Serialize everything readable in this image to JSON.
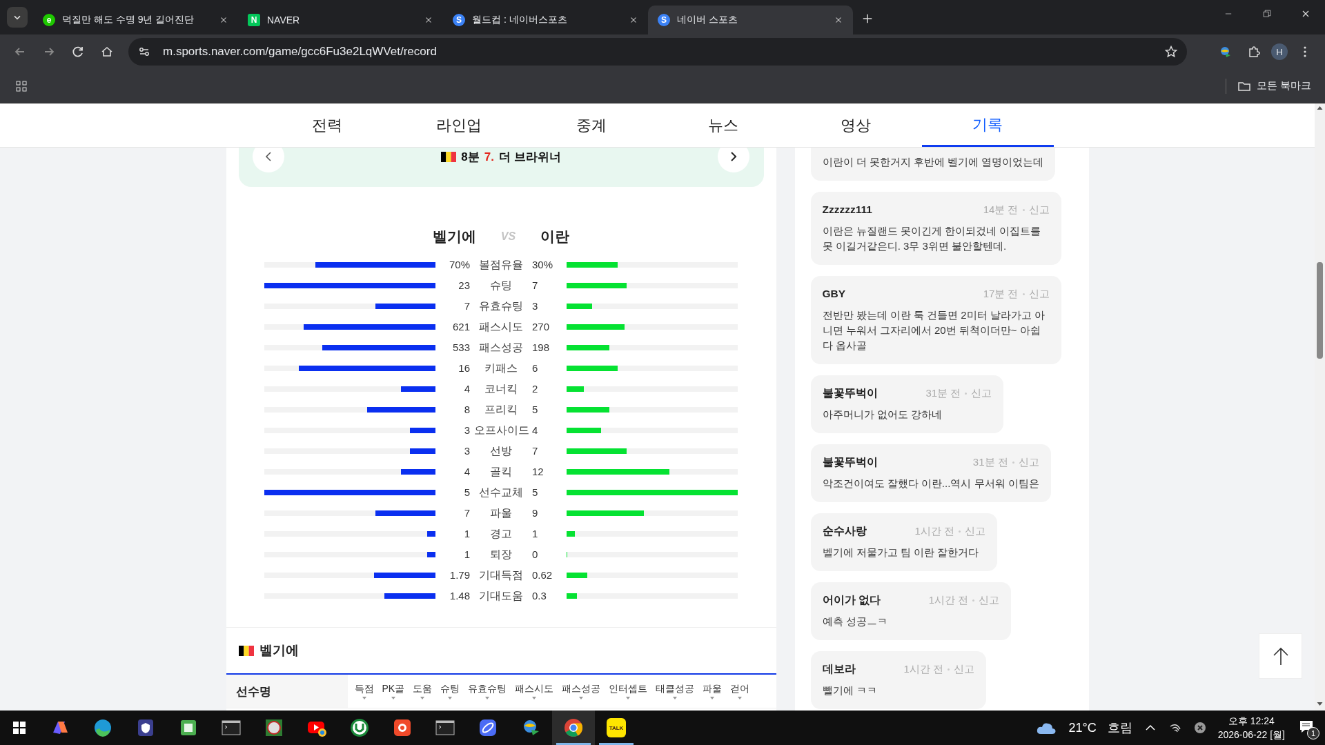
{
  "browser": {
    "tabs": [
      {
        "title": "덕질만 해도 수명 9년 길어진단",
        "favicon": {
          "kind": "circle",
          "color": "#1ec800",
          "letter": "e"
        },
        "selected": false
      },
      {
        "title": "NAVER",
        "favicon": {
          "kind": "square",
          "color": "#03c75a",
          "letter": "N"
        },
        "selected": false
      },
      {
        "title": "월드컵 : 네이버스포츠",
        "favicon": {
          "kind": "circle",
          "color": "#3b82f6",
          "letter": "S"
        },
        "selected": false
      },
      {
        "title": "네이버 스포츠",
        "favicon": {
          "kind": "circle",
          "color": "#3b82f6",
          "letter": "S"
        },
        "selected": true
      }
    ],
    "url": "m.sports.naver.com/game/gcc6Fu3e2LqWVet/record",
    "profile": "H",
    "bookmarks_label": "모든 북마크"
  },
  "nav": [
    {
      "label": "전력",
      "selected": false
    },
    {
      "label": "라인업",
      "selected": false
    },
    {
      "label": "중계",
      "selected": false
    },
    {
      "label": "뉴스",
      "selected": false
    },
    {
      "label": "영상",
      "selected": false
    },
    {
      "label": "기록",
      "selected": true
    }
  ],
  "event_banner": {
    "minute": "8분",
    "number": "7.",
    "player": "더 브라위너"
  },
  "matchup": {
    "home": "벨기에",
    "vs": "VS",
    "away": "이란"
  },
  "stats": [
    {
      "home": {
        "value": "70%",
        "level": 0.7
      },
      "label": "볼점유율",
      "away": {
        "value": "30%",
        "level": 0.3
      }
    },
    {
      "home": {
        "value": "23",
        "level": 1.0
      },
      "label": "슈팅",
      "away": {
        "value": "7",
        "level": 0.35
      }
    },
    {
      "home": {
        "value": "7",
        "level": 0.35
      },
      "label": "유효슈팅",
      "away": {
        "value": "3",
        "level": 0.15
      }
    },
    {
      "home": {
        "value": "621",
        "level": 0.77
      },
      "label": "패스시도",
      "away": {
        "value": "270",
        "level": 0.34
      }
    },
    {
      "home": {
        "value": "533",
        "level": 0.66
      },
      "label": "패스성공",
      "away": {
        "value": "198",
        "level": 0.25
      }
    },
    {
      "home": {
        "value": "16",
        "level": 0.8
      },
      "label": "키패스",
      "away": {
        "value": "6",
        "level": 0.3
      }
    },
    {
      "home": {
        "value": "4",
        "level": 0.2
      },
      "label": "코너킥",
      "away": {
        "value": "2",
        "level": 0.1
      }
    },
    {
      "home": {
        "value": "8",
        "level": 0.4
      },
      "label": "프리킥",
      "away": {
        "value": "5",
        "level": 0.25
      }
    },
    {
      "home": {
        "value": "3",
        "level": 0.15
      },
      "label": "오프사이드",
      "away": {
        "value": "4",
        "level": 0.2
      }
    },
    {
      "home": {
        "value": "3",
        "level": 0.15
      },
      "label": "선방",
      "away": {
        "value": "7",
        "level": 0.35
      }
    },
    {
      "home": {
        "value": "4",
        "level": 0.2
      },
      "label": "골킥",
      "away": {
        "value": "12",
        "level": 0.6
      }
    },
    {
      "home": {
        "value": "5",
        "level": 1.0
      },
      "label": "선수교체",
      "away": {
        "value": "5",
        "level": 1.0
      }
    },
    {
      "home": {
        "value": "7",
        "level": 0.35
      },
      "label": "파울",
      "away": {
        "value": "9",
        "level": 0.45
      }
    },
    {
      "home": {
        "value": "1",
        "level": 0.05
      },
      "label": "경고",
      "away": {
        "value": "1",
        "level": 0.05
      }
    },
    {
      "home": {
        "value": "1",
        "level": 0.05
      },
      "label": "퇴장",
      "away": {
        "value": "0",
        "level": 0
      }
    },
    {
      "home": {
        "value": "1.79",
        "level": 0.36
      },
      "label": "기대득점",
      "away": {
        "value": "0.62",
        "level": 0.12
      }
    },
    {
      "home": {
        "value": "1.48",
        "level": 0.3
      },
      "label": "기대도움",
      "away": {
        "value": "0.3",
        "level": 0.06
      }
    }
  ],
  "player_table": {
    "team": "벨기에",
    "name_column": "선수명",
    "columns": [
      "득점",
      "PK골",
      "도움",
      "슈팅",
      "유효슈팅",
      "패스시도",
      "패스성공",
      "인터셉트",
      "태클성공",
      "파울",
      "걷어"
    ]
  },
  "comments": [
    {
      "text": "이란이 더 못한거지 후반에 벨기에 열명이었는데"
    },
    {
      "author": "Zzzzzz111",
      "time": "14분 전",
      "report": "신고",
      "text": "이란은 뉴질랜드 못이긴게 한이되겄네 이집트를 못 이길거같은디. 3무 3위면 불안할텐데."
    },
    {
      "author": "GBY",
      "time": "17분 전",
      "report": "신고",
      "text": "전반만 봤는데 이란 툭 건들면 2미터 날라가고 아니면 누워서 그자리에서 20번 뒤쳑이더만~ 아쉽다 옵사골"
    },
    {
      "author": "불꽃뚜벅이",
      "time": "31분 전",
      "report": "신고",
      "text": "아주머니가 없어도 강하네"
    },
    {
      "author": "불꽃뚜벅이",
      "time": "31분 전",
      "report": "신고",
      "text": "악조건이여도 잘했다 이란...역시 무서워 이팀은"
    },
    {
      "author": "순수사랑",
      "time": "1시간 전",
      "report": "신고",
      "text": "벨기에 저물가고 팀 이란 잘한거다"
    },
    {
      "author": "어이가 없다",
      "time": "1시간 전",
      "report": "신고",
      "text": "예측 성공ㅡㅋ"
    },
    {
      "author": "데보라",
      "time": "1시간 전",
      "report": "신고",
      "text": "뺄기에 ㅋㅋ"
    }
  ],
  "taskbar": {
    "apps": [
      {
        "kind": "copilot",
        "selected": false,
        "open": false
      },
      {
        "kind": "edge",
        "selected": false,
        "open": false
      },
      {
        "kind": "shield",
        "selected": false,
        "open": false
      },
      {
        "kind": "green",
        "selected": false,
        "open": false
      },
      {
        "kind": "terminal",
        "selected": false,
        "open": false
      },
      {
        "kind": "seal",
        "selected": false,
        "open": false
      },
      {
        "kind": "youtube",
        "selected": false,
        "open": false
      },
      {
        "kind": "torrent",
        "selected": false,
        "open": false
      },
      {
        "kind": "camera",
        "selected": false,
        "open": false
      },
      {
        "kind": "terminal",
        "selected": false,
        "open": false
      },
      {
        "kind": "orbit",
        "selected": false,
        "open": false
      },
      {
        "kind": "globe",
        "selected": false,
        "open": false
      },
      {
        "kind": "chrome",
        "selected": true,
        "open": true
      },
      {
        "kind": "chat",
        "label": "TALK",
        "selected": false,
        "open": true
      }
    ],
    "weather": {
      "temp": "21°C",
      "condition": "흐림"
    },
    "time": "오후 12:24",
    "date": "2026-06-22 [월]",
    "notifications": "1"
  }
}
